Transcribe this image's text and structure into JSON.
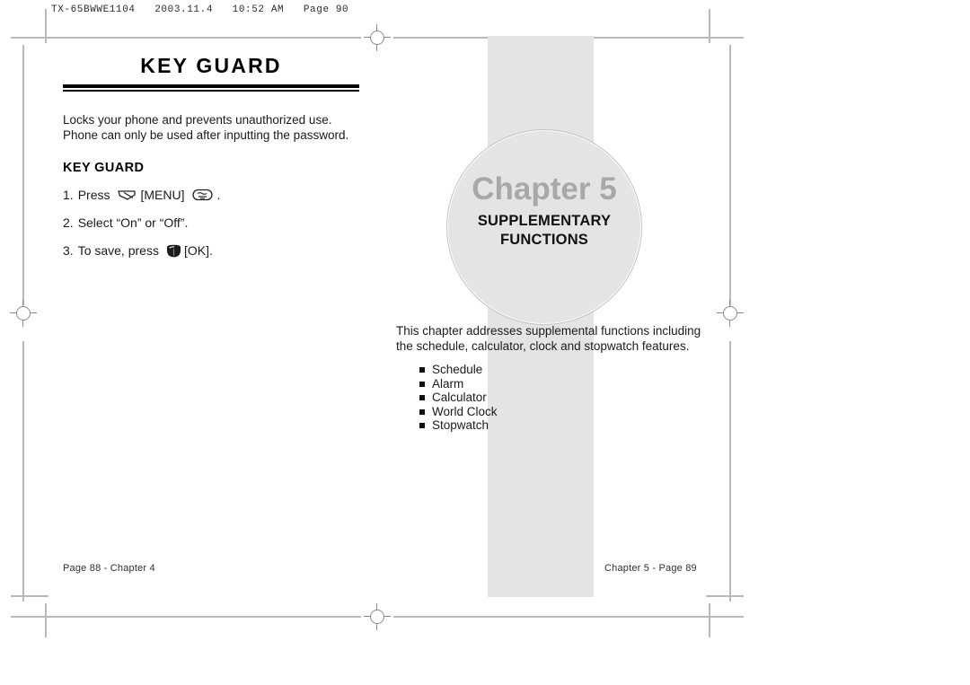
{
  "slug": "TX-65BWWE1104   2003.11.4   10:52 AM   Page 90",
  "left_page": {
    "title": "KEY GUARD",
    "intro_line1": "Locks your phone and prevents unauthorized use.",
    "intro_line2": "Phone can only be used after inputting the password.",
    "section_heading": "KEY GUARD",
    "steps": [
      {
        "number": "1.",
        "text_before": "Press",
        "icon1": "soft-key-icon",
        "label": "[MENU]",
        "icon2": "menu-key-icon",
        "text_after": "."
      },
      {
        "number": "2.",
        "text_before": "Select “On” or “Off”.",
        "label": "",
        "text_after": ""
      },
      {
        "number": "3.",
        "text_before": "To save, press",
        "icon1": "ok-key-icon",
        "label": "[OK].",
        "text_after": ""
      }
    ],
    "footer": "Page 88 - Chapter 4"
  },
  "right_page": {
    "chapter_word": "Chapter 5",
    "chapter_subtitle_line1": "SUPPLEMENTARY",
    "chapter_subtitle_line2": "FUNCTIONS",
    "description_line1": "This chapter addresses supplemental functions including",
    "description_line2": "the schedule, calculator, clock and stopwatch features.",
    "features": [
      "Schedule",
      "Alarm",
      "Calculator",
      "World Clock",
      "Stopwatch"
    ],
    "footer": "Chapter 5 - Page 89"
  },
  "colors": {
    "band_gray": "#e4e4e4",
    "circle_fill": "#e4e4e4",
    "circle_stroke": "#c3c3c3",
    "chapter_word_gray": "#a8a8a8",
    "mark_gray": "#b9b9b9",
    "text_black": "#111111"
  }
}
